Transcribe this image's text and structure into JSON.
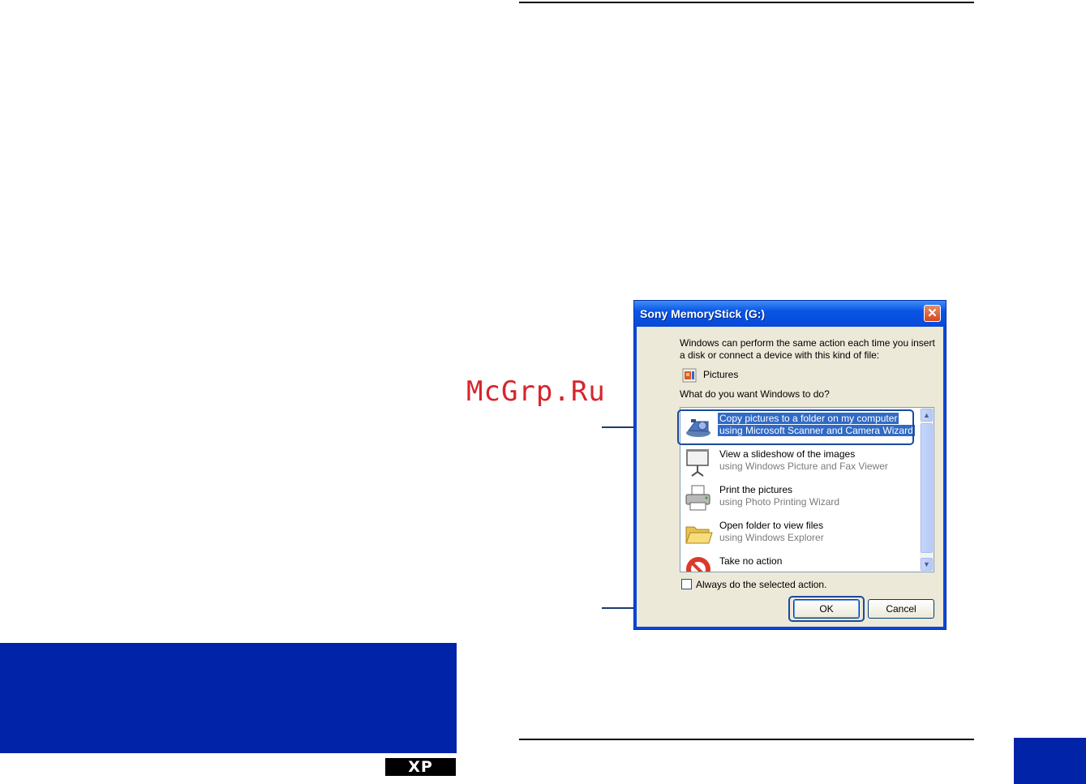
{
  "watermark": "McGrp.Ru",
  "xp_badge": "XP",
  "dialog": {
    "title": "Sony MemoryStick (G:)",
    "intro": "Windows can perform the same action each time you insert a disk or connect a device with this kind of file:",
    "content_type": "Pictures",
    "question": "What do you want Windows to do?",
    "actions": [
      {
        "title": "Copy pictures to a folder on my computer",
        "subtitle": "using Microsoft Scanner and Camera Wizard",
        "icon": "camera-icon",
        "selected": true
      },
      {
        "title": "View a slideshow of the images",
        "subtitle": "using Windows Picture and Fax Viewer",
        "icon": "projector-screen-icon",
        "selected": false
      },
      {
        "title": "Print the pictures",
        "subtitle": "using Photo Printing Wizard",
        "icon": "printer-icon",
        "selected": false
      },
      {
        "title": "Open folder to view files",
        "subtitle": "using Windows Explorer",
        "icon": "folder-icon",
        "selected": false
      },
      {
        "title": "Take no action",
        "subtitle": "",
        "icon": "no-action-icon",
        "selected": false
      }
    ],
    "always_checkbox_label": "Always do the selected action.",
    "always_checked": false,
    "ok_label": "OK",
    "cancel_label": "Cancel"
  },
  "colors": {
    "accent_blue": "#0023a8",
    "selection": "#316ac5",
    "callout": "#1a4b9c",
    "watermark": "#d8242c"
  }
}
